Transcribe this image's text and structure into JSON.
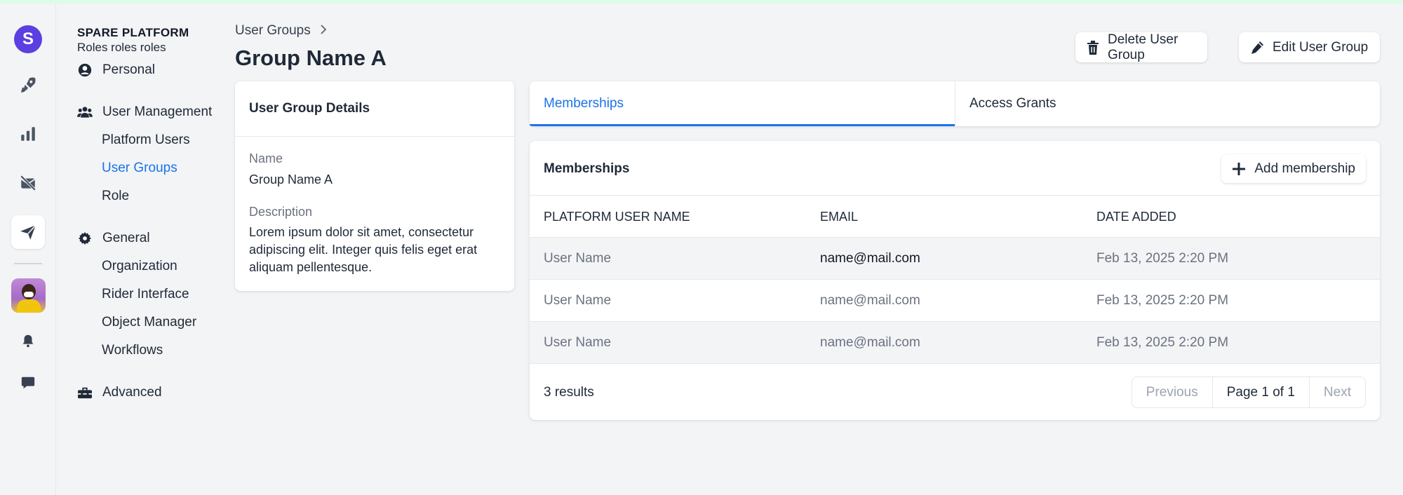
{
  "rail": {
    "logo_letter": "S",
    "icons": [
      "rocket-icon",
      "bar-chart-icon",
      "mail-off-icon",
      "send-icon",
      "bell-icon",
      "chat-icon"
    ]
  },
  "brand": {
    "title": "SPARE PLATFORM",
    "subtitle": "Roles roles roles"
  },
  "nav": {
    "personal": "Personal",
    "user_management": "User Management",
    "um_items": [
      "Platform Users",
      "User Groups",
      "Role"
    ],
    "general": "General",
    "general_items": [
      "Organization",
      "Rider Interface",
      "Object Manager",
      "Workflows"
    ],
    "advanced": "Advanced"
  },
  "header": {
    "breadcrumb": "User Groups",
    "title": "Group Name A",
    "delete_label": "Delete User Group",
    "edit_label": "Edit User Group"
  },
  "details": {
    "heading": "User Group Details",
    "name_label": "Name",
    "name_value": "Group Name A",
    "description_label": "Description",
    "description_value": "Lorem ipsum dolor sit amet, consectetur adipiscing elit. Integer quis felis eget erat aliquam pellentesque."
  },
  "tabs": [
    "Memberships",
    "Access Grants"
  ],
  "memberships": {
    "title": "Memberships",
    "add_label": "Add membership",
    "columns": [
      "PLATFORM USER NAME",
      "EMAIL",
      "DATE ADDED"
    ],
    "rows": [
      {
        "name": "User Name",
        "email": "name@mail.com",
        "date": "Feb 13, 2025 2:20 PM"
      },
      {
        "name": "User Name",
        "email": "name@mail.com",
        "date": "Feb 13, 2025 2:20 PM"
      },
      {
        "name": "User Name",
        "email": "name@mail.com",
        "date": "Feb 13, 2025 2:20 PM"
      }
    ],
    "results": "3 results",
    "prev": "Previous",
    "page_info": "Page 1 of 1",
    "next": "Next"
  },
  "colors": {
    "accent": "#1a73e8",
    "brand": "#5b3fe0"
  }
}
